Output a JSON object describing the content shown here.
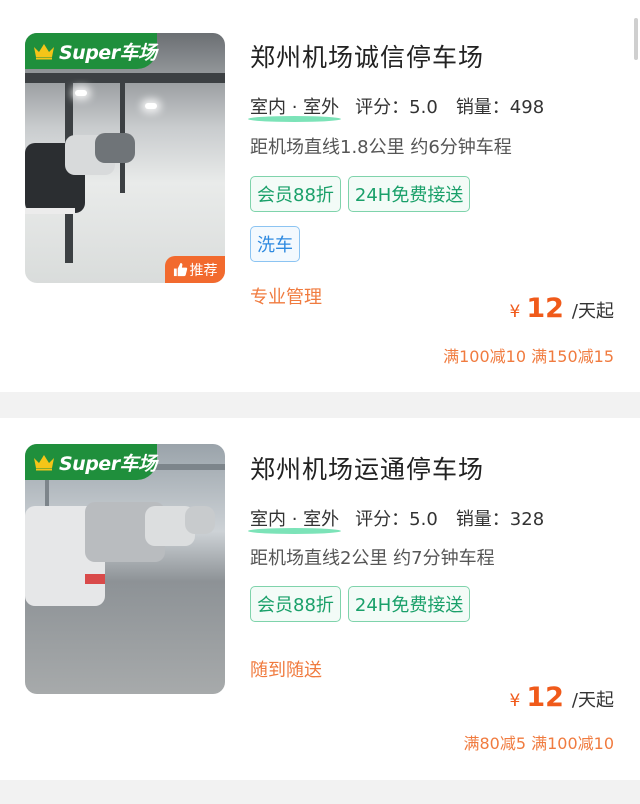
{
  "listings": [
    {
      "super_label": "Super车场",
      "recommend_label": "推荐",
      "title": "郑州机场诚信停车场",
      "type": "室内 · 室外",
      "rating": "评分：5.0",
      "sales": "销量：498",
      "distance": "距机场直线1.8公里 约6分钟车程",
      "tags": [
        "会员88折",
        "24H免费接送"
      ],
      "service_tag": "洗车",
      "feature": "专业管理",
      "currency": "¥",
      "price": "12",
      "price_unit": "/天起",
      "discount": "满100减10 满150减15"
    },
    {
      "super_label": "Super车场",
      "title": "郑州机场运通停车场",
      "type": "室内 · 室外",
      "rating": "评分：5.0",
      "sales": "销量：328",
      "distance": "距机场直线2公里 约7分钟车程",
      "tags": [
        "会员88折",
        "24H免费接送"
      ],
      "feature": "随到随送",
      "currency": "¥",
      "price": "12",
      "price_unit": "/天起",
      "discount": "满80减5 满100减10"
    }
  ],
  "colors": {
    "super_green": "#1f8f3c",
    "tag_green": "#1aa06a",
    "tag_blue": "#2f8ae0",
    "price_orange": "#f05a1a",
    "recommend_orange": "#f26a2e"
  }
}
